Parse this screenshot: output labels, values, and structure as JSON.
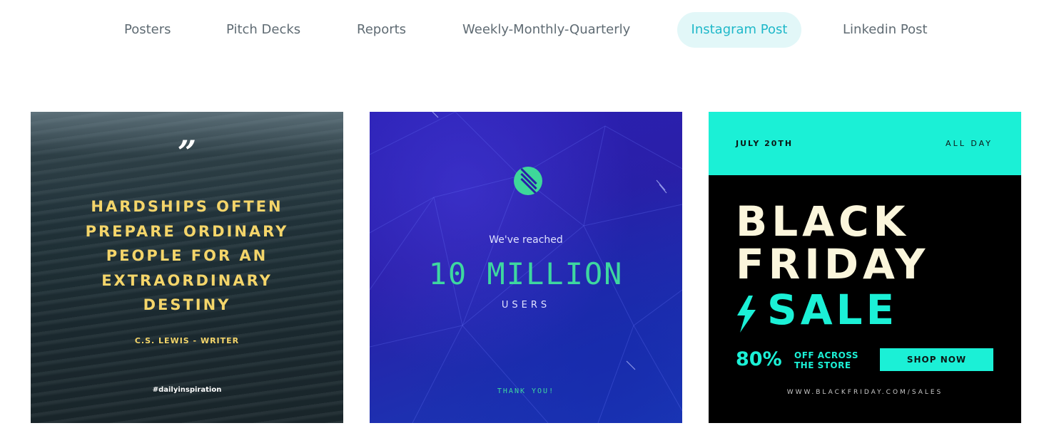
{
  "tabs": [
    {
      "label": "Posters"
    },
    {
      "label": "Pitch Decks"
    },
    {
      "label": "Reports"
    },
    {
      "label": "Weekly-Monthly-Quarterly"
    },
    {
      "label": "Instagram Post",
      "active": true
    },
    {
      "label": "Linkedin Post"
    }
  ],
  "cards": {
    "quote": {
      "quote_mark": "”",
      "lines": [
        "HARDSHIPS OFTEN",
        "PREPARE ORDINARY",
        "PEOPLE FOR AN",
        "EXTRAORDINARY",
        "DESTINY"
      ],
      "author": "C.S. LEWIS - WRITER",
      "hashtag": "#dailyinspiration",
      "text_color": "#f4d56a"
    },
    "milestone": {
      "logo_icon": "stripes-circle-icon",
      "reached": "We've reached",
      "big": "10 MILLION",
      "users": "USERS",
      "thanks": "THANK YOU!",
      "accent_color": "#3ed7a0",
      "background_color": "#2a1fa8"
    },
    "sale": {
      "date": "JULY 20TH",
      "all_day": "ALL DAY",
      "headline_1": "BLACK",
      "headline_2": "FRIDAY",
      "bolt_icon": "lightning-bolt-icon",
      "sale": "SALE",
      "percent": "80%",
      "offer_1": "OFF ACROSS",
      "offer_2": "THE STORE",
      "shop_button": "SHOP NOW",
      "url": "WWW.BLACKFRIDAY.COM/SALES",
      "accent_color": "#1bf0d6",
      "headline_color": "#fbf6dc"
    }
  }
}
